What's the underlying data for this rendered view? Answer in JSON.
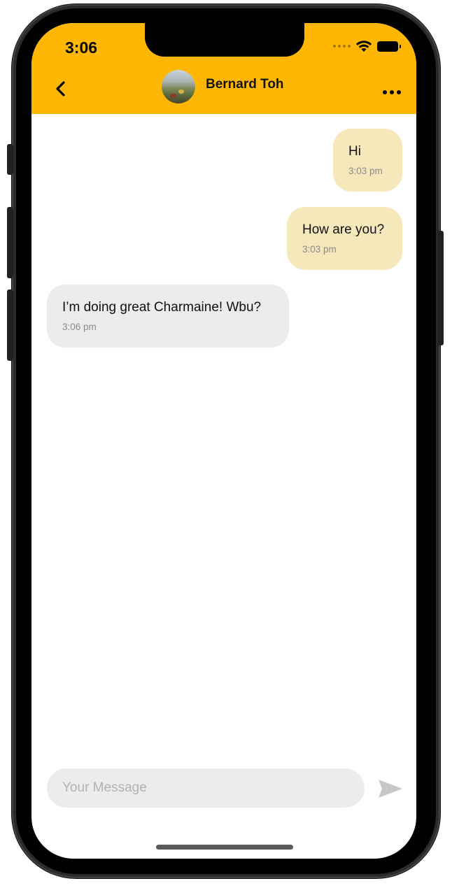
{
  "colors": {
    "accent": "#FFB703",
    "sent_bubble": "#F5E8BB",
    "received_bubble": "#ECECEC"
  },
  "status_bar": {
    "time": "3:06",
    "icons": [
      "cellular-signal-icon",
      "wifi-icon",
      "battery-icon"
    ]
  },
  "header": {
    "back_icon": "chevron-left-icon",
    "contact_name": "Bernard Toh",
    "more_icon": "ellipsis-icon"
  },
  "messages": [
    {
      "direction": "sent",
      "text": "Hi",
      "time": "3:03 pm"
    },
    {
      "direction": "sent",
      "text": "How are you?",
      "time": "3:03 pm"
    },
    {
      "direction": "received",
      "text": "I’m doing great Charmaine! Wbu?",
      "time": "3:06 pm"
    }
  ],
  "composer": {
    "placeholder": "Your Message",
    "value": "",
    "send_icon": "send-icon"
  }
}
